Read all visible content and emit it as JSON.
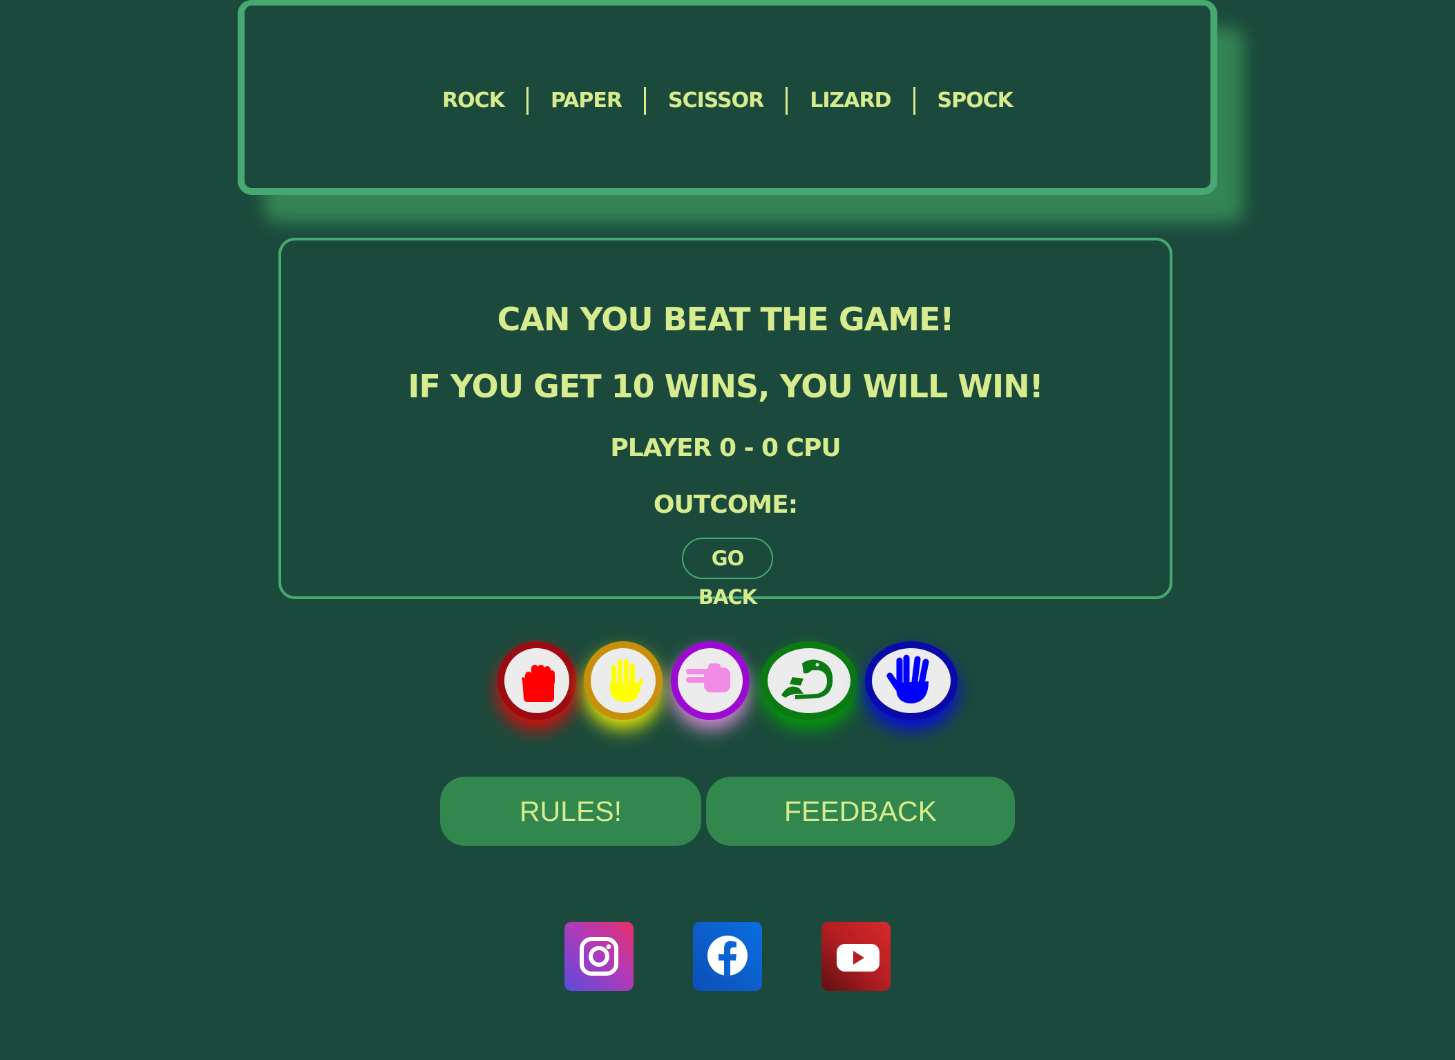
{
  "nav": {
    "items": [
      {
        "label": "ROCK"
      },
      {
        "label": "PAPER"
      },
      {
        "label": "SCISSOR"
      },
      {
        "label": "LIZARD"
      },
      {
        "label": "SPOCK"
      }
    ]
  },
  "game": {
    "heading": "CAN YOU BEAT THE GAME!",
    "subheading": "IF YOU GET 10 WINS, YOU WILL WIN!",
    "score": "PLAYER 0 - 0 CPU",
    "outcome": "OUTCOME:",
    "go_back_label": "GO BACK"
  },
  "choices": [
    {
      "name": "rock",
      "icon": "fist-icon",
      "color": "#ff0000"
    },
    {
      "name": "paper",
      "icon": "open-hand-icon",
      "color": "#ffff00"
    },
    {
      "name": "scissor",
      "icon": "pointing-hand-icon",
      "color": "#f08be6"
    },
    {
      "name": "lizard",
      "icon": "lizard-icon",
      "color": "#0b7a12"
    },
    {
      "name": "spock",
      "icon": "vulcan-salute-icon",
      "color": "#0000ff"
    }
  ],
  "actions": {
    "rules_label": "RULES!",
    "feedback_label": "FEEDBACK"
  },
  "social": [
    {
      "name": "instagram",
      "icon": "instagram-icon"
    },
    {
      "name": "facebook",
      "icon": "facebook-icon"
    },
    {
      "name": "youtube",
      "icon": "youtube-icon"
    }
  ],
  "colors": {
    "background": "#1b4a3c",
    "accent": "#47a872",
    "text": "#d7ec8e",
    "button": "#32874e"
  }
}
